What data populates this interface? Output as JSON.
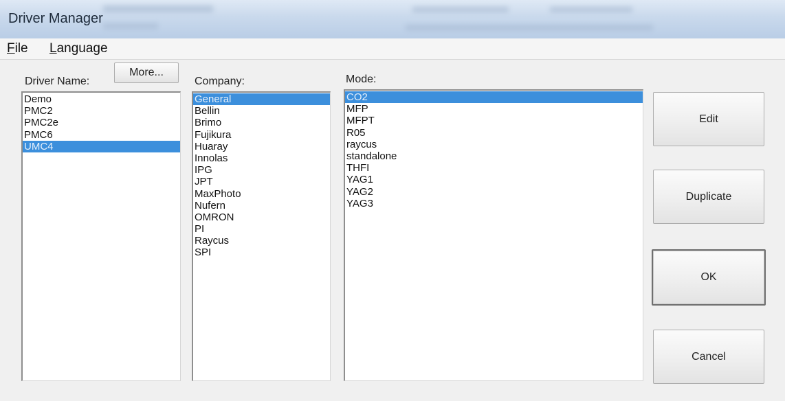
{
  "window": {
    "title": "Driver Manager"
  },
  "menubar": {
    "file": {
      "mnemonic": "F",
      "rest": "ile"
    },
    "language": {
      "mnemonic": "L",
      "rest": "anguage"
    }
  },
  "driver": {
    "label": "Driver Name:",
    "more_button": "More...",
    "items": [
      "Demo",
      "PMC2",
      "PMC2e",
      "PMC6",
      "UMC4"
    ],
    "selected": "UMC4"
  },
  "company": {
    "label": "Company:",
    "items": [
      "General",
      "Bellin",
      "Brimo",
      "Fujikura",
      "Huaray",
      "Innolas",
      "IPG",
      "JPT",
      "MaxPhoto",
      "Nufern",
      "OMRON",
      "PI",
      "Raycus",
      "SPI"
    ],
    "selected": "General"
  },
  "mode": {
    "label": "Mode:",
    "items": [
      "CO2",
      "MFP",
      "MFPT",
      "R05",
      "raycus",
      "standalone",
      "THFI",
      "YAG1",
      "YAG2",
      "YAG3"
    ],
    "selected": "CO2"
  },
  "buttons": {
    "edit": "Edit",
    "duplicate": "Duplicate",
    "ok": "OK",
    "cancel": "Cancel"
  },
  "colors": {
    "selection": "#3c8fdc",
    "selection_text": "#e6f0fb"
  }
}
